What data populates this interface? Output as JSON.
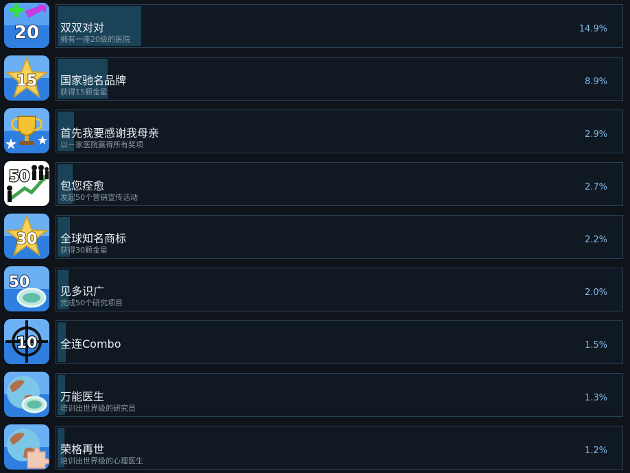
{
  "achievements": [
    {
      "title": "双双对对",
      "desc": "拥有一座20级的医院",
      "pct_label": "14.9%",
      "percent": 14.9,
      "icon": "plus-20-icon",
      "icon_text": "20"
    },
    {
      "title": "国家驰名品牌",
      "desc": "获得15颗金星",
      "pct_label": "8.9%",
      "percent": 8.9,
      "icon": "star-15-icon",
      "icon_text": "15"
    },
    {
      "title": "首先我要感谢我母亲",
      "desc": "以一家医院赢得所有奖项",
      "pct_label": "2.9%",
      "percent": 2.9,
      "icon": "trophy-icon",
      "icon_text": ""
    },
    {
      "title": "包您痊愈",
      "desc": "发起50个营销宣传活动",
      "pct_label": "2.7%",
      "percent": 2.7,
      "icon": "growth-50-icon",
      "icon_text": "50"
    },
    {
      "title": "全球知名商标",
      "desc": "获得30颗金星",
      "pct_label": "2.2%",
      "percent": 2.2,
      "icon": "star-30-icon",
      "icon_text": "30"
    },
    {
      "title": "见多识广",
      "desc": "完成50个研究项目",
      "pct_label": "2.0%",
      "percent": 2.0,
      "icon": "petri-50-icon",
      "icon_text": "50"
    },
    {
      "title": "全连Combo",
      "desc": "",
      "pct_label": "1.5%",
      "percent": 1.5,
      "icon": "crosshair-10-icon",
      "icon_text": "10"
    },
    {
      "title": "万能医生",
      "desc": "培训出世界级的研究员",
      "pct_label": "1.3%",
      "percent": 1.3,
      "icon": "globe-petri-icon",
      "icon_text": ""
    },
    {
      "title": "荣格再世",
      "desc": "培训出世界级的心理医生",
      "pct_label": "1.2%",
      "percent": 1.2,
      "icon": "globe-puzzle-icon",
      "icon_text": ""
    }
  ],
  "colors": {
    "bar": "#1b4358",
    "percent_text": "#7fb7e6",
    "title_text": "#e8edf2",
    "desc_text": "#8a99a6"
  }
}
